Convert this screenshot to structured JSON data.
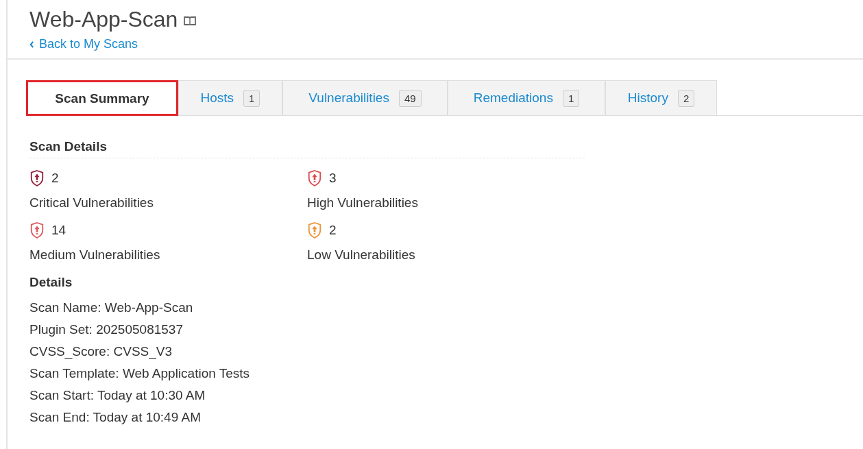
{
  "title": "Web-App-Scan",
  "back_link": "Back to My Scans",
  "tabs": [
    {
      "label": "Scan Summary",
      "selected": true,
      "highlighted": true
    },
    {
      "label": "Hosts",
      "count": "1",
      "selected": false,
      "highlighted": false
    },
    {
      "label": "Vulnerabilities",
      "count": "49",
      "selected": false,
      "highlighted": false
    },
    {
      "label": "Remediations",
      "count": "1",
      "selected": false,
      "highlighted": false
    },
    {
      "label": "History",
      "count": "2",
      "selected": false,
      "highlighted": false
    }
  ],
  "scan_details": {
    "heading": "Scan Details",
    "stats": [
      {
        "count": "2",
        "label": "Critical Vulnerabilities",
        "color": "#91243e"
      },
      {
        "count": "3",
        "label": "High Vulnerabilities",
        "color": "#dd4b50"
      },
      {
        "count": "14",
        "label": "Medium Vulnerabilities",
        "color": "#e05a5f"
      },
      {
        "count": "2",
        "label": "Low Vulnerabilities",
        "color": "#ee9336"
      }
    ]
  },
  "details": {
    "heading": "Details",
    "lines": [
      "Scan Name: Web-App-Scan",
      "Plugin Set: 202505081537",
      "CVSS_Score: CVSS_V3",
      "Scan Template: Web Application Tests",
      "Scan Start: Today at 10:30 AM",
      "Scan End: Today at 10:49 AM"
    ]
  }
}
